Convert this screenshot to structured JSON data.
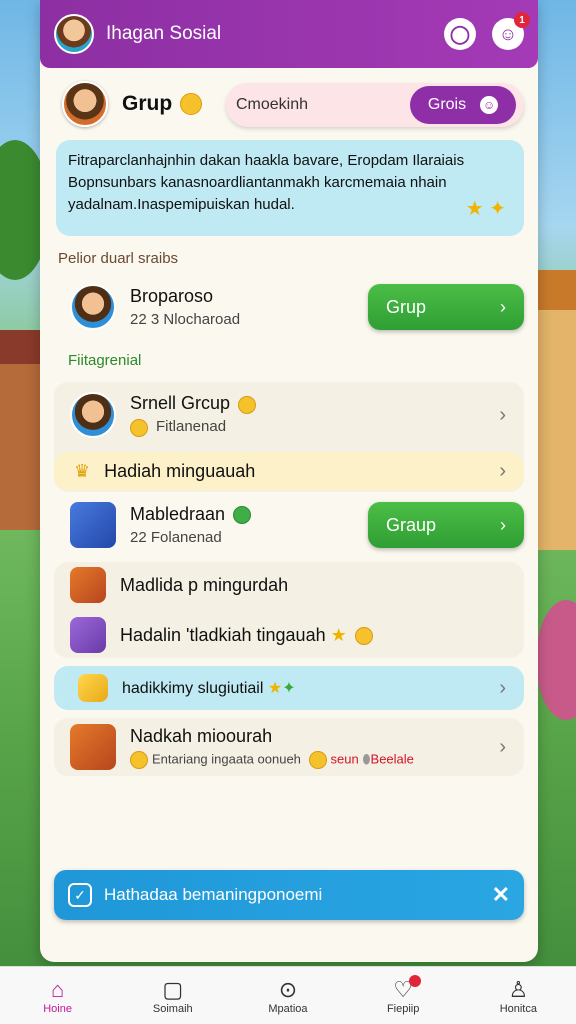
{
  "header": {
    "title": "Ihagan Sosial",
    "notif_count": "1"
  },
  "group": {
    "title": "Grup",
    "search_placeholder": "Cmoekinh",
    "button_label": "Grois"
  },
  "info": {
    "text": "Fitraparclanhajnhin dakan haakla bavare, Eropdam Ilaraiais Bopnsunbars kanasnoardliantanmakh karcmemaia nhain yadalnam.Inaspemipuiskan hudal."
  },
  "sections": {
    "label1": "Pelior duarl sraibs",
    "label2": "Fiitagrenial"
  },
  "rows": [
    {
      "title": "Broparoso",
      "sub": "22  3 Nlocharoad",
      "button": "Grup"
    },
    {
      "title": "Srnell Grcup",
      "sub": "Fitlanenad"
    },
    {
      "title": "Hadiah minguauah"
    },
    {
      "title": "Mabledraan",
      "sub": "22  Folanenad",
      "button": "Graup"
    },
    {
      "title": "Madlida p mingurdah"
    },
    {
      "title": "Hadalin 'tladkiah tingauah"
    },
    {
      "title": "hadikkimy slugiutiail"
    },
    {
      "title": "Nadkah mioourah",
      "sub": "Entariang ingaata oonueh",
      "sub_red": "seun",
      "sub_red2": "Beelale"
    }
  ],
  "banner": {
    "text": "Hathadaa bemaningponoemi"
  },
  "nav": [
    "Hoine",
    "Soimaih",
    "Mpatioa",
    "Fiepiip",
    "Honitca"
  ],
  "colors": {
    "brand": "#9b35ad",
    "green": "#3aac3c",
    "banner": "#229fdd",
    "nav_active": "#c2179b"
  }
}
